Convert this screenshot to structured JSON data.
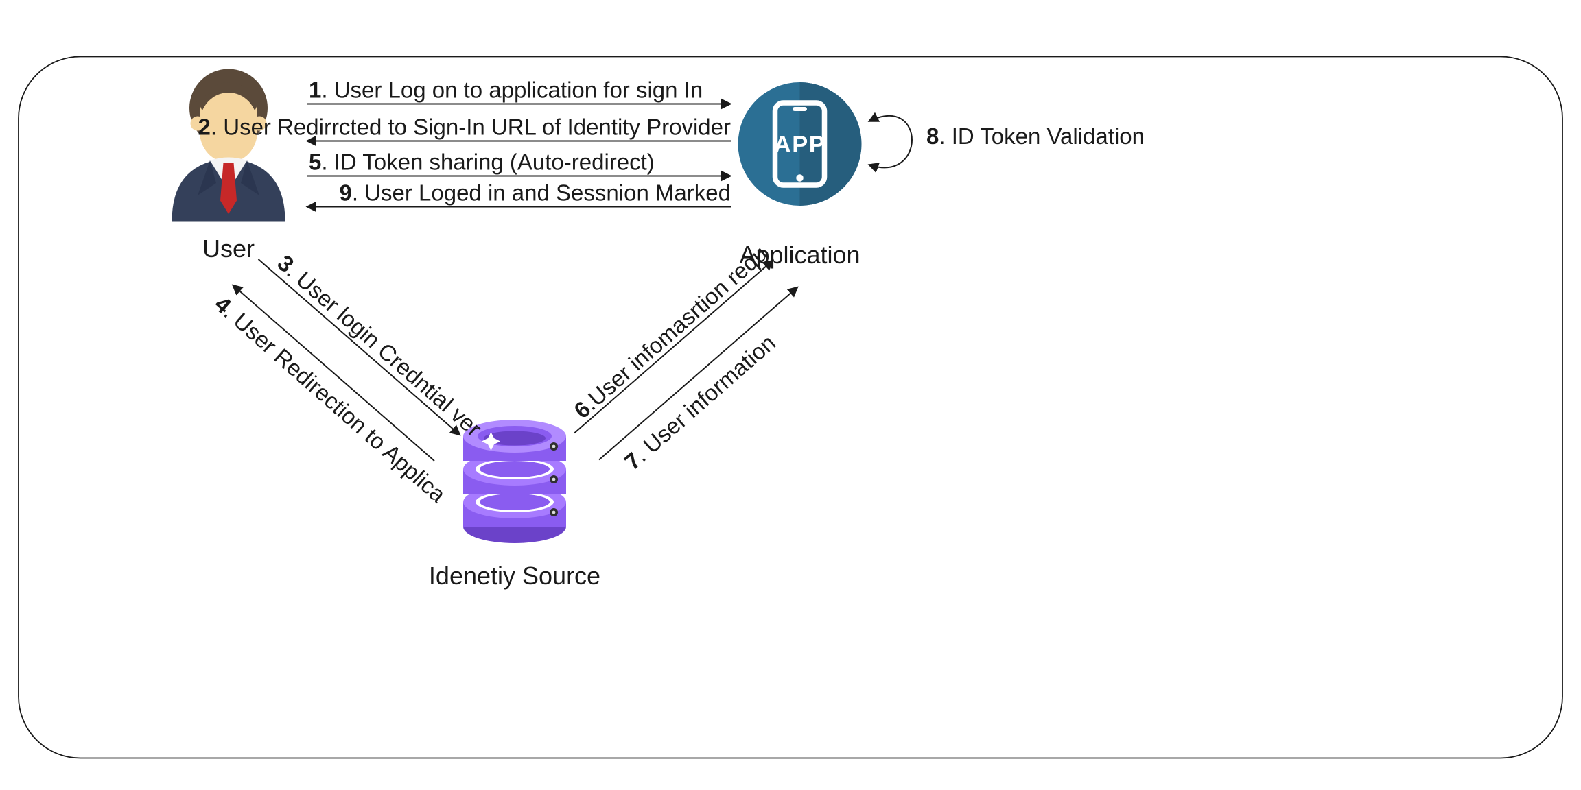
{
  "nodes": {
    "user": {
      "label": "User"
    },
    "application": {
      "label": "Application",
      "app_text": "APP"
    },
    "identity_source": {
      "label": "Idenetiy Source"
    }
  },
  "steps": {
    "s1": {
      "num": "1",
      "text": ". User Log on to application for sign In"
    },
    "s2": {
      "num": "2",
      "text": ". User Redirrcted to Sign-In URL of Identity Provider"
    },
    "s3": {
      "num": "3",
      "text": ". User login Credntial verfication"
    },
    "s4": {
      "num": "4",
      "text": ". User Redirection to Application + ID/Access Token"
    },
    "s5": {
      "num": "5",
      "text": ". ID Token sharing (Auto-redirect)"
    },
    "s6": {
      "num": "6",
      "text": ".User infomasrtion request"
    },
    "s7": {
      "num": "7",
      "text": ". User information"
    },
    "s8": {
      "num": "8",
      "text": ". ID Token Validation"
    },
    "s9": {
      "num": "9",
      "text": ". User Loged in and Sessnion Marked"
    }
  }
}
